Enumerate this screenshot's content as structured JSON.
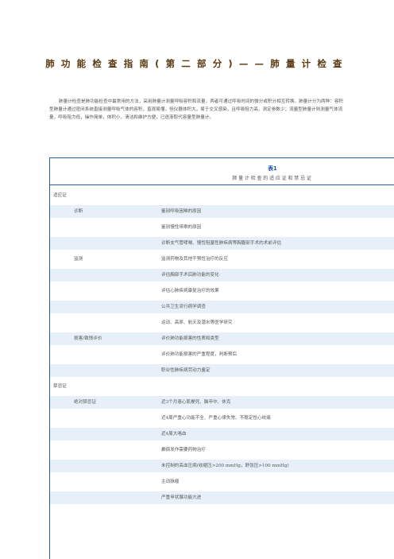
{
  "document": {
    "title": "肺功能检查指南(第二部分)——肺量计检查",
    "intro": "肺量计检查是肺功能检查中最常用的方法，采用肺量计测量呼吸容积和流量，两者可通过呼吸时间的微分或积分相互转换。肺量计分为两种：容积型肺量计通过密闭系统直接测量呼吸气体的容积，直观易懂，但仪器体积大，易于交叉感染，且呼吸阻力高，测定参数少；流量型肺量计则测量气体流量，呼吸阻力低，操作简单，体积小，清洁和维护方便，已逐渐取代容量型肺量计。"
  },
  "table": {
    "title": "表1",
    "subtitle": "肺量计检查的适应证和禁忌证",
    "sections": [
      {
        "heading": "适应证",
        "groups": [
          {
            "category": "诊断",
            "items": [
              "鉴别呼吸困难的原因",
              "鉴别慢性咳嗽的原因",
              "诊断支气管哮喘、慢性阻塞性肺疾病等胸腹部手术的术前评估"
            ]
          },
          {
            "category": "监测",
            "items": [
              "监测药物及其他干预性治疗的反应",
              "评估胸部手术后肺功能的变化",
              "评估心肺疾病康复治疗的效果",
              "公共卫生流行病学调查",
              "运动、高原、航天及潜水等医学研究"
            ]
          },
          {
            "category": "损害/致残评价",
            "items": [
              "评价肺功能损害的性质和类型",
              "评价肺功能损害的严重程度，判断预后",
              "职业性肺疾病劳动力鉴定"
            ]
          }
        ]
      },
      {
        "heading": "禁忌证",
        "groups": [
          {
            "category": "绝对禁忌证",
            "items": [
              "近3个月患心肌梗死、脑卒中、休克",
              "近4周严重心功能不全、严重心律失常、不稳定性心绞痛",
              "近4周大咯血",
              "癫痫发作需要药物治疗",
              "未控制的高血压病(收缩压>200 mmHg，舒张压>100 mmHg)",
              "主动脉瘤",
              "严重甲状腺功能亢进"
            ]
          }
        ]
      }
    ]
  }
}
